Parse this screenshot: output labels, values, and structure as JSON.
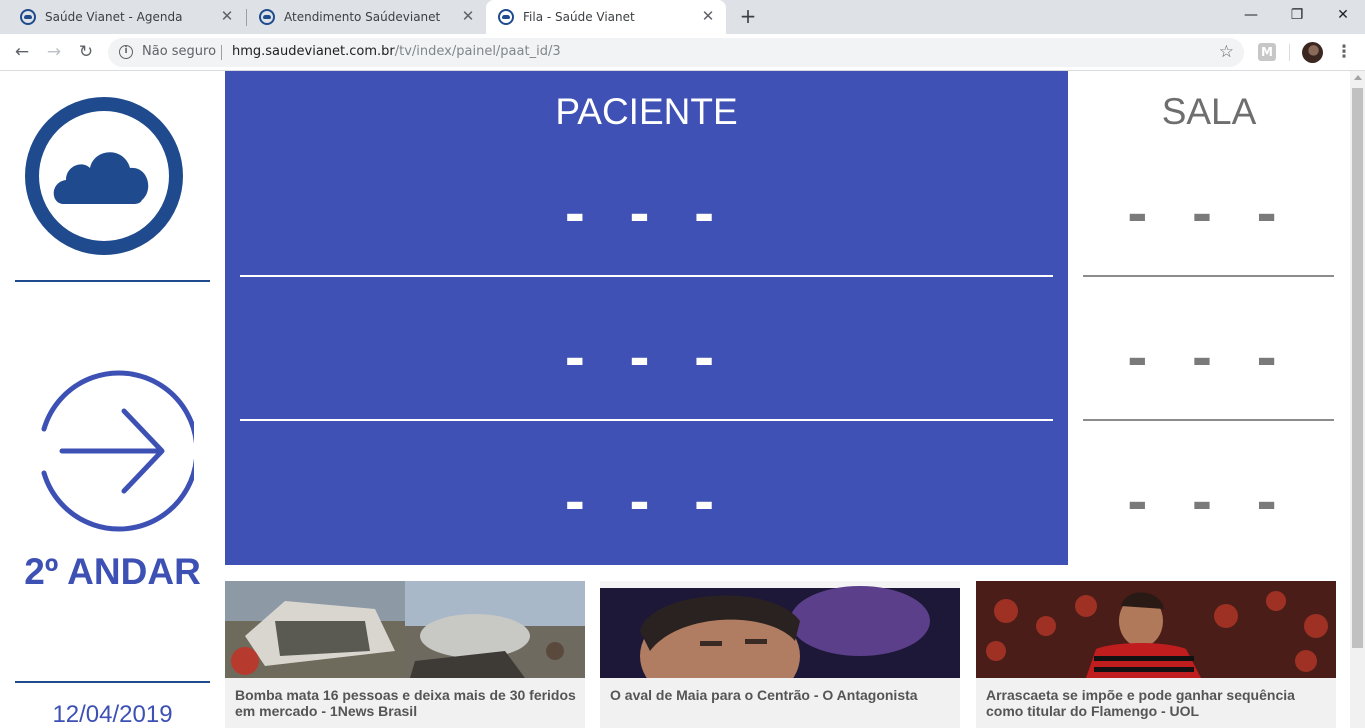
{
  "browser": {
    "tabs": [
      {
        "title": "Saúde Vianet - Agenda",
        "active": false
      },
      {
        "title": "Atendimento Saúdevianet",
        "active": false
      },
      {
        "title": "Fila - Saúde Vianet",
        "active": true
      }
    ],
    "address": {
      "security_label": "Não seguro",
      "host": "hmg.saudevianet.com.br",
      "path": "/tv/index/painel/paat_id/3"
    }
  },
  "panel": {
    "paciente_header": "PACIENTE",
    "sala_header": "SALA",
    "rows": [
      {
        "paciente": "- - -",
        "sala": "- - -"
      },
      {
        "paciente": "- - -",
        "sala": "- - -"
      },
      {
        "paciente": "- - -",
        "sala": "- - -"
      }
    ],
    "floor": "2º ANDAR",
    "date": "12/04/2019",
    "colors": {
      "primary": "#3f51b5",
      "brand": "#1f4b8e"
    }
  },
  "news": [
    {
      "caption": "Bomba mata 16 pessoas e deixa mais de 30 feridos em mercado - 1News Brasil"
    },
    {
      "caption": "O aval de Maia para o Centrão - O Antagonista"
    },
    {
      "caption": "Arrascaeta se impõe e pode ganhar sequência como titular do Flamengo - UOL"
    }
  ]
}
